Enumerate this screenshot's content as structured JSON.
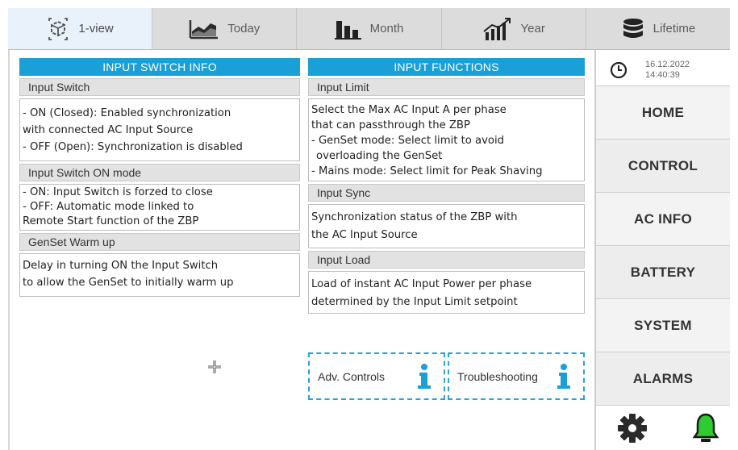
{
  "tabs": [
    {
      "label": "1-view",
      "icon": "cube-view-icon",
      "active": true
    },
    {
      "label": "Today",
      "icon": "area-chart-icon",
      "active": false
    },
    {
      "label": "Month",
      "icon": "bar-chart-icon",
      "active": false
    },
    {
      "label": "Year",
      "icon": "trend-up-icon",
      "active": false
    },
    {
      "label": "Lifetime",
      "icon": "database-icon",
      "active": false
    }
  ],
  "left_panel": {
    "header": "INPUT SWITCH INFO",
    "sections": [
      {
        "title": "Input Switch",
        "lines": [
          "- ON (Closed): Enabled synchronization",
          "with connected AC Input Source",
          "- OFF (Open): Synchronization is disabled"
        ]
      },
      {
        "title": "Input Switch ON mode",
        "lines": [
          "- ON: Input Switch is forzed to close",
          "- OFF: Automatic mode linked to",
          "Remote Start function of the ZBP"
        ]
      },
      {
        "title": "GenSet Warm up",
        "lines": [
          "Delay in turning ON the Input Switch",
          "to allow the GenSet to initially warm up"
        ]
      }
    ]
  },
  "mid_panel": {
    "header": "INPUT FUNCTIONS",
    "sections": [
      {
        "title": "Input Limit",
        "lines": [
          "Select the Max AC Input A per phase",
          "that can passthrough the ZBP",
          "- GenSet mode: Select limit to avoid",
          "overloading the GenSet",
          "- Mains mode: Select limit for Peak Shaving"
        ]
      },
      {
        "title": "Input Sync",
        "lines": [
          "Synchronization status of the ZBP with",
          "the AC Input Source"
        ]
      },
      {
        "title": "Input Load",
        "lines": [
          "Load of instant AC Input Power per phase",
          "determined by the Input Limit setpoint"
        ]
      }
    ]
  },
  "actions": {
    "adv_controls": "Adv. Controls",
    "troubleshooting": "Troubleshooting",
    "info_icon": "info-icon"
  },
  "clock": {
    "date": "16.12.2022",
    "time": "14:40:39"
  },
  "nav": [
    "HOME",
    "CONTROL",
    "AC INFO",
    "BATTERY",
    "SYSTEM",
    "ALARMS"
  ],
  "footer": {
    "settings_icon": "gear-icon",
    "alarm_icon": "alarm-bell-icon"
  },
  "colors": {
    "accent": "#1a9fd6",
    "alarm_green": "#2ecc2e"
  }
}
